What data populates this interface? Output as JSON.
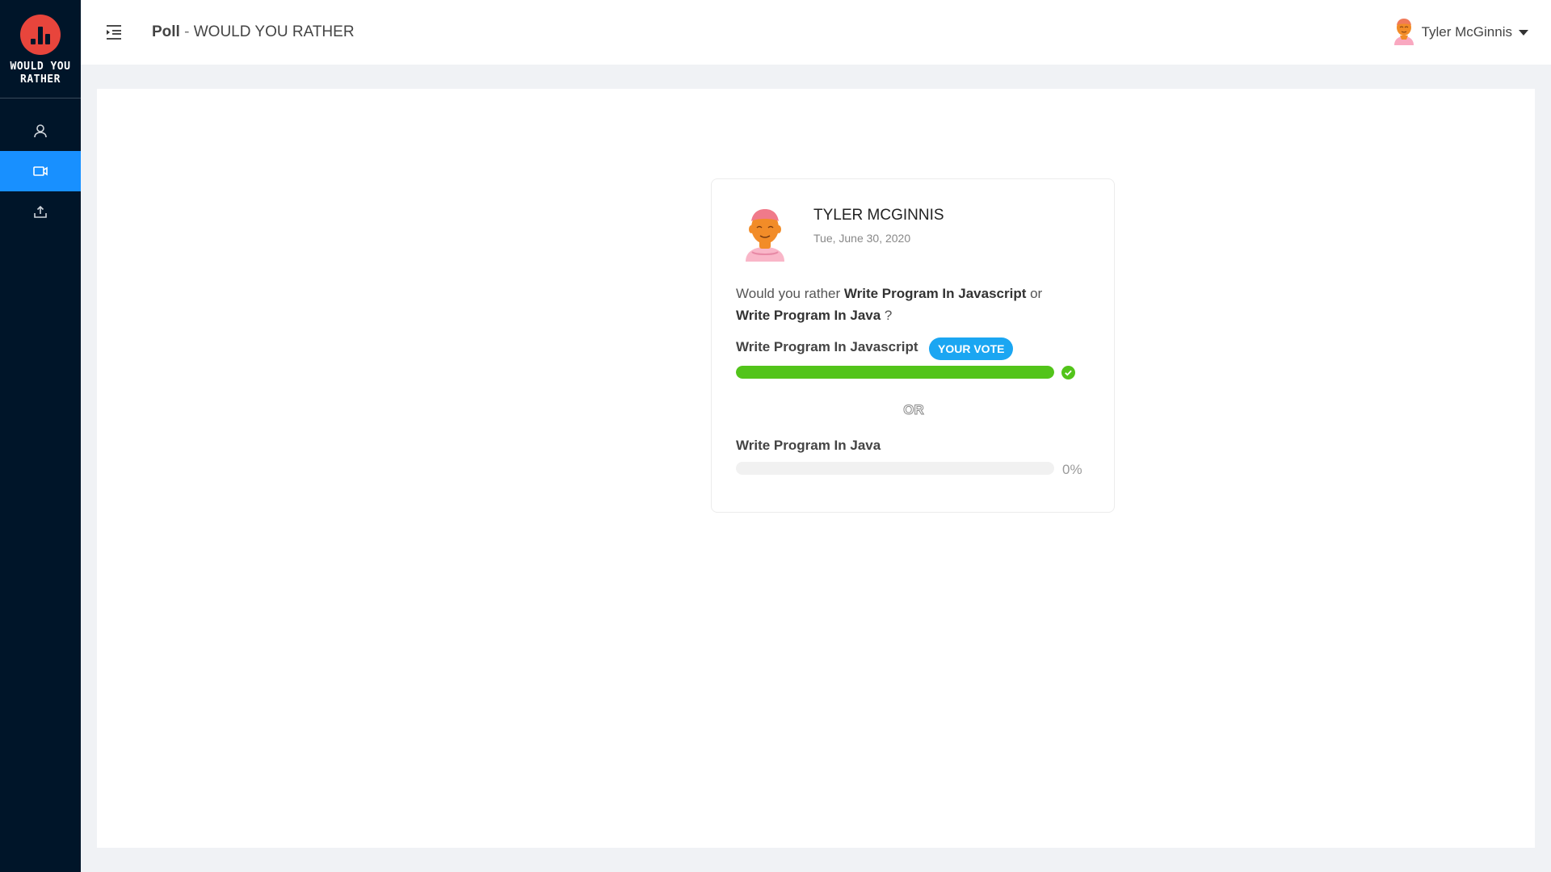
{
  "app": {
    "logo_text": "WOULD  YOU\nRATHER",
    "accent": "#1890ff",
    "sidebar_bg": "#001529",
    "logo_color": "#e8453c"
  },
  "sidebar": {
    "items": [
      {
        "icon": "user-icon",
        "active": false
      },
      {
        "icon": "video-icon",
        "active": true
      },
      {
        "icon": "upload-icon",
        "active": false
      }
    ]
  },
  "header": {
    "title_strong": "Poll",
    "title_separator": " - ",
    "title_rest": "WOULD YOU RATHER",
    "user_name": "Tyler McGinnis"
  },
  "poll": {
    "author": "TYLER MCGINNIS",
    "date": "Tue, June 30, 2020",
    "question_prefix": "Would you rather ",
    "option_one": "Write Program In Javascript",
    "question_or": " or",
    "option_two": "Write Program In Java",
    "question_suffix": " ?",
    "your_vote_label": "YOUR VOTE",
    "option_one_percent": 100,
    "option_two_percent_label": "0%",
    "option_two_percent": 0,
    "or_label": "OR",
    "progress_color": "#52c41a",
    "badge_color": "#1ba6f2"
  }
}
